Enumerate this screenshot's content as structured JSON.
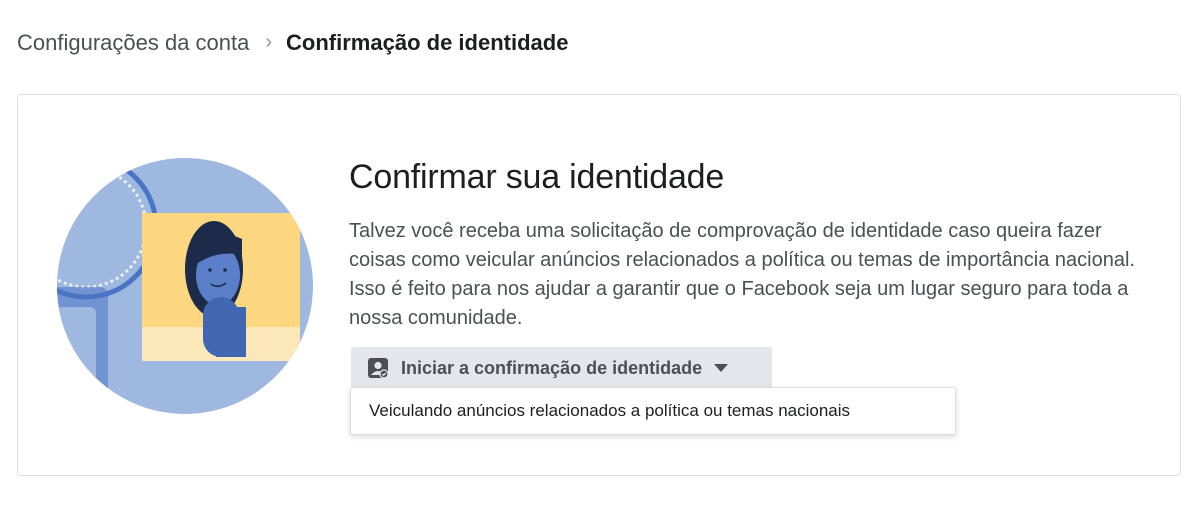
{
  "breadcrumb": {
    "parent": "Configurações da conta",
    "separator": "›",
    "current": "Confirmação de identidade"
  },
  "card": {
    "title": "Confirmar sua identidade",
    "description": "Talvez você receba uma solicitação de comprovação de identidade caso queira fazer coisas como veicular anúncios relacionados a política ou temas de importância nacional. Isso é feito para nos ajudar a garantir que o Facebook seja um lugar seguro para toda a nossa comunidade.",
    "illustration_icon": "person-identity-illustration"
  },
  "action": {
    "icon": "id-badge-icon",
    "label": "Iniciar a confirmação de identidade",
    "caret_icon": "caret-down-icon"
  },
  "dropdown": {
    "items": [
      "Veiculando anúncios relacionados a política ou temas nacionais"
    ]
  },
  "colors": {
    "circle_bg": "#9fb8e0",
    "card_yellow": "#fcd77f",
    "person_blue": "#4267b2",
    "button_bg": "#e4e6eb"
  }
}
